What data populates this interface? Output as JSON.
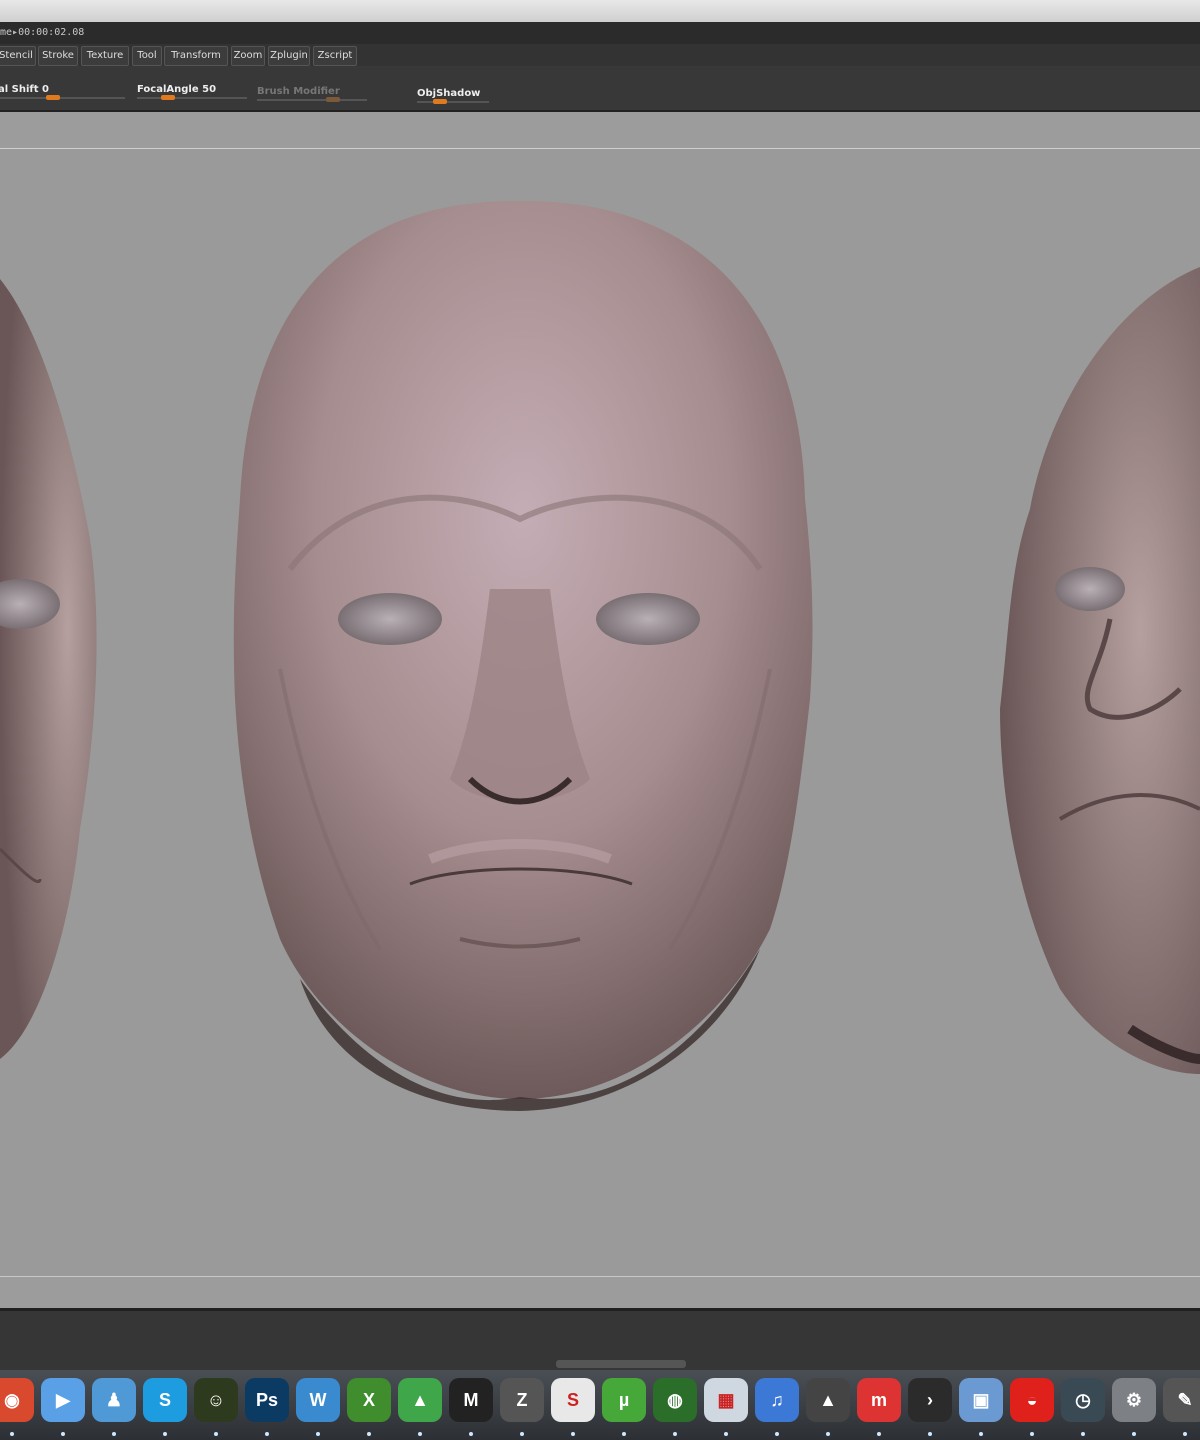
{
  "timeline": {
    "label": "me",
    "time": "00:00:02.08"
  },
  "menu_tabs": [
    {
      "label": "Stencil"
    },
    {
      "label": "Stroke"
    },
    {
      "label": "Texture"
    },
    {
      "label": "Tool"
    },
    {
      "label": "Transform"
    },
    {
      "label": "Zoom"
    },
    {
      "label": "Zplugin"
    },
    {
      "label": "Zscript"
    }
  ],
  "sliders": [
    {
      "label": "al Shift 0",
      "enabled": true,
      "value": 0
    },
    {
      "label": "FocalAngle 50",
      "enabled": true,
      "value": 50
    },
    {
      "label": "Brush Modifier",
      "enabled": false,
      "value": 0
    },
    {
      "label": "ObjShadow",
      "enabled": true,
      "value": 0
    }
  ],
  "viewport": {
    "subject": "sculpted-head-front",
    "skin_color": "#a88f8f"
  },
  "dock": [
    {
      "icon": "chrome-icon",
      "color": "#d9492e",
      "glyph": "◉"
    },
    {
      "icon": "facetime-icon",
      "color": "#5aa0e6",
      "glyph": "▶"
    },
    {
      "icon": "messenger-icon",
      "color": "#4f9ad6",
      "glyph": "♟"
    },
    {
      "icon": "skype-icon",
      "color": "#1d9de0",
      "glyph": "S"
    },
    {
      "icon": "family-icon",
      "color": "#2e3a1e",
      "glyph": "☺"
    },
    {
      "icon": "photoshop-icon",
      "color": "#0b3a63",
      "glyph": "Ps"
    },
    {
      "icon": "word-icon",
      "color": "#3a8ad0",
      "glyph": "W"
    },
    {
      "icon": "excel-icon",
      "color": "#3f8d2c",
      "glyph": "X"
    },
    {
      "icon": "pyramid-icon",
      "color": "#3fa74a",
      "glyph": "▲"
    },
    {
      "icon": "maya-icon",
      "color": "#222",
      "glyph": "M"
    },
    {
      "icon": "zbrush-icon",
      "color": "#555",
      "glyph": "Z"
    },
    {
      "icon": "sbp-icon",
      "color": "#e8e8e8",
      "glyph": "S"
    },
    {
      "icon": "utorrent-icon",
      "color": "#47a83a",
      "glyph": "µ"
    },
    {
      "icon": "globe-icon",
      "color": "#2a6e2a",
      "glyph": "◍"
    },
    {
      "icon": "monitor-icon",
      "color": "#cfd7e0",
      "glyph": "▦"
    },
    {
      "icon": "itunes-icon",
      "color": "#3c79d6",
      "glyph": "♫"
    },
    {
      "icon": "vlc-icon",
      "color": "#444",
      "glyph": "▲"
    },
    {
      "icon": "miro-icon",
      "color": "#d33",
      "glyph": "m"
    },
    {
      "icon": "plex-icon",
      "color": "#2b2b2b",
      "glyph": "›"
    },
    {
      "icon": "preview-icon",
      "color": "#6b9ad3",
      "glyph": "▣"
    },
    {
      "icon": "vodafone-icon",
      "color": "#e0201a",
      "glyph": "◒"
    },
    {
      "icon": "timemachine-icon",
      "color": "#3a4a55",
      "glyph": "◷"
    },
    {
      "icon": "system-prefs-icon",
      "color": "#7d8085",
      "glyph": "⚙"
    },
    {
      "icon": "microphone-icon",
      "color": "#555",
      "glyph": "✎"
    }
  ]
}
